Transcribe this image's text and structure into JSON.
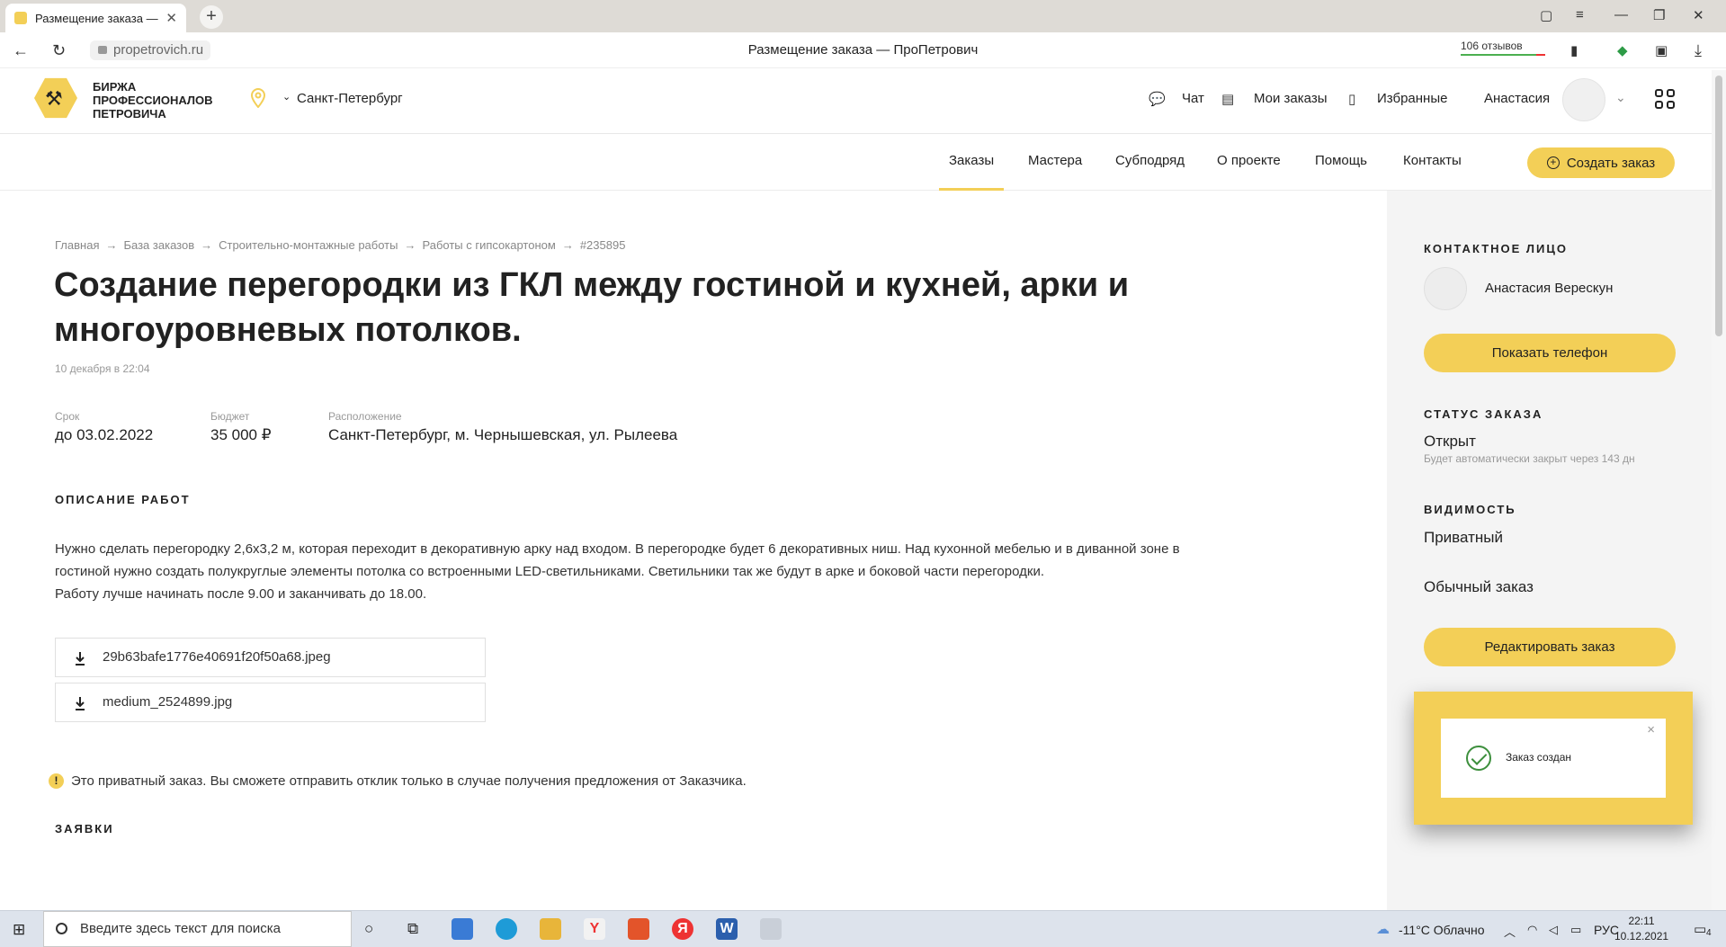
{
  "browser": {
    "tab_title": "Размещение заказа —",
    "url": "propetrovich.ru",
    "page_title": "Размещение заказа — ПроПетрович",
    "reviews": "106 отзывов"
  },
  "header": {
    "brand": "БИРЖА ПРОФЕССИОНАЛОВ ПЕТРОВИЧА",
    "city": "Санкт-Петербург",
    "chat": "Чат",
    "my_orders": "Мои заказы",
    "favorites": "Избранные",
    "user_name": "Анастасия"
  },
  "main_nav": {
    "items": [
      "Заказы",
      "Мастера",
      "Субподряд",
      "О проекте",
      "Помощь",
      "Контакты"
    ],
    "create_button": "Создать заказ"
  },
  "breadcrumbs": [
    "Главная",
    "База заказов",
    "Строительно-монтажные работы",
    "Работы с гипсокартоном",
    "#235895"
  ],
  "order": {
    "title": "Создание перегородки из ГКЛ между гостиной и кухней, арки и многоуровневых потолков.",
    "date": "10 декабря в 22:04",
    "deadline_label": "Срок",
    "deadline": "до 03.02.2022",
    "budget_label": "Бюджет",
    "budget": "35 000 ₽",
    "location_label": "Расположение",
    "location": "Санкт-Петербург, м. Чернышевская, ул. Рылеева",
    "description_heading": "ОПИСАНИЕ РАБОТ",
    "description_line1": "Нужно сделать перегородку 2,6х3,2 м, которая переходит в декоративную арку над входом. В перегородке будет 6 декоративных ниш. Над кухонной мебелью и в диванной зоне в гостиной нужно создать полукруглые элементы потолка со встроенными LED-светильниками. Светильники так же будут в арке и боковой части перегородки.",
    "description_line2": "Работу лучше начинать после 9.00 и заканчивать до 18.00.",
    "files": [
      "29b63bafe1776e40691f20f50a68.jpeg",
      "medium_2524899.jpg"
    ],
    "private_notice": "Это приватный заказ. Вы сможете отправить отклик только в случае получения предложения от Заказчика.",
    "applications_heading": "ЗАЯВКИ"
  },
  "sidebar": {
    "contact_heading": "КОНТАКТНОЕ ЛИЦО",
    "contact_name": "Анастасия Верескун",
    "show_phone": "Показать телефон",
    "status_heading": "СТАТУС ЗАКАЗА",
    "status": "Открыт",
    "status_note": "Будет автоматически закрыт через 143 дн",
    "visibility_heading": "ВИДИМОСТЬ",
    "visibility": "Приватный",
    "order_type": "Обычный заказ",
    "edit_button": "Редактировать заказ"
  },
  "toast": {
    "message": "Заказ создан"
  },
  "taskbar": {
    "search_placeholder": "Введите здесь текст для поиска",
    "weather": "-11°C Облачно",
    "lang": "РУС",
    "time": "22:11",
    "date": "10.12.2021",
    "notifications": "4"
  },
  "colors": {
    "accent": "#f3cf57",
    "sidebar_bg": "#f4f4f4",
    "success": "#3d8f3d"
  }
}
